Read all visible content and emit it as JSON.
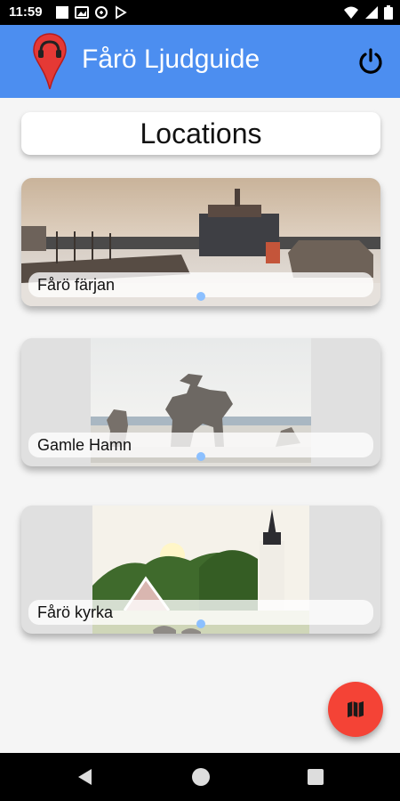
{
  "status_bar": {
    "time": "11:59"
  },
  "app_bar": {
    "title": "Fårö Ljudguide",
    "color": "#4c8ef0"
  },
  "header": {
    "title": "Locations"
  },
  "locations": [
    {
      "name": "Fårö färjan"
    },
    {
      "name": "Gamle Hamn"
    },
    {
      "name": "Fårö kyrka"
    }
  ],
  "fab": {
    "icon": "map-icon",
    "color": "#f44336"
  },
  "nav_bar": {
    "icons": [
      "back-icon",
      "home-icon",
      "recents-icon"
    ]
  }
}
